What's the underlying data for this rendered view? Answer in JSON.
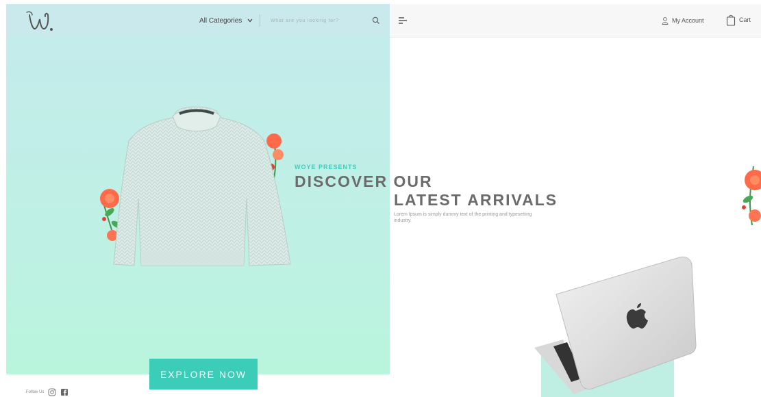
{
  "header": {
    "category_label": "All Categories",
    "search_placeholder": "What are you looking for?",
    "account_label": "My Account",
    "cart_label": "Cart"
  },
  "hero": {
    "eyebrow": "WOYE PRESENTS",
    "headline_line1": "DISCOVER OUR",
    "headline_line2": "LATEST ARRIVALS",
    "description": "Lorem Ipsum is simply dummy text of the printing and typesetting industry.",
    "cta_label": "EXPLORE NOW"
  },
  "footer": {
    "follow_label": "Follow Us"
  },
  "icons": {
    "logo": "logo-w-icon",
    "category_dropdown": "chevron-down-icon",
    "search": "search-icon",
    "menu": "hamburger-menu-icon",
    "account": "user-icon",
    "cart": "shopping-bag-icon",
    "instagram": "instagram-icon",
    "facebook": "facebook-icon"
  },
  "colors": {
    "accent": "#3ccdb8",
    "panel_top": "#c4ebec",
    "panel_bottom": "#b9f5dd",
    "headline": "#6b6b6b",
    "eyebrow": "#35d0bf"
  }
}
